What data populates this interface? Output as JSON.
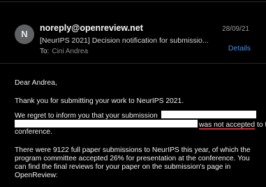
{
  "email": {
    "avatar_letter": "N",
    "sender": "noreply@openreview.net",
    "subject": "[NeurIPS 2021] Decision notification for submissio...",
    "to_label": "To:",
    "to_name": "Cini Andrea",
    "date": "28/09/21",
    "details_label": "Details"
  },
  "body": {
    "greeting": "Dear Andrea,",
    "thanks": "Thank you for submitting your work to NeurIPS 2021.",
    "regret_prefix": "We regret to inform you that your submission",
    "regret_highlight": "was not accepted",
    "regret_suffix": "to the",
    "regret_end": "conference.",
    "stats_line1": "There were 9122 full paper submissions to NeurIPS this year, of which the",
    "stats_line2": "program committee accepted 26% for presentation at the conference.  You",
    "stats_line3": "can find the final reviews for your paper on the submission's page in",
    "stats_line4": "OpenReview:"
  },
  "colors": {
    "background": "#000000",
    "link": "#4a8fe0",
    "highlight_underline": "#d12a2a",
    "redaction": "#ffffff"
  }
}
